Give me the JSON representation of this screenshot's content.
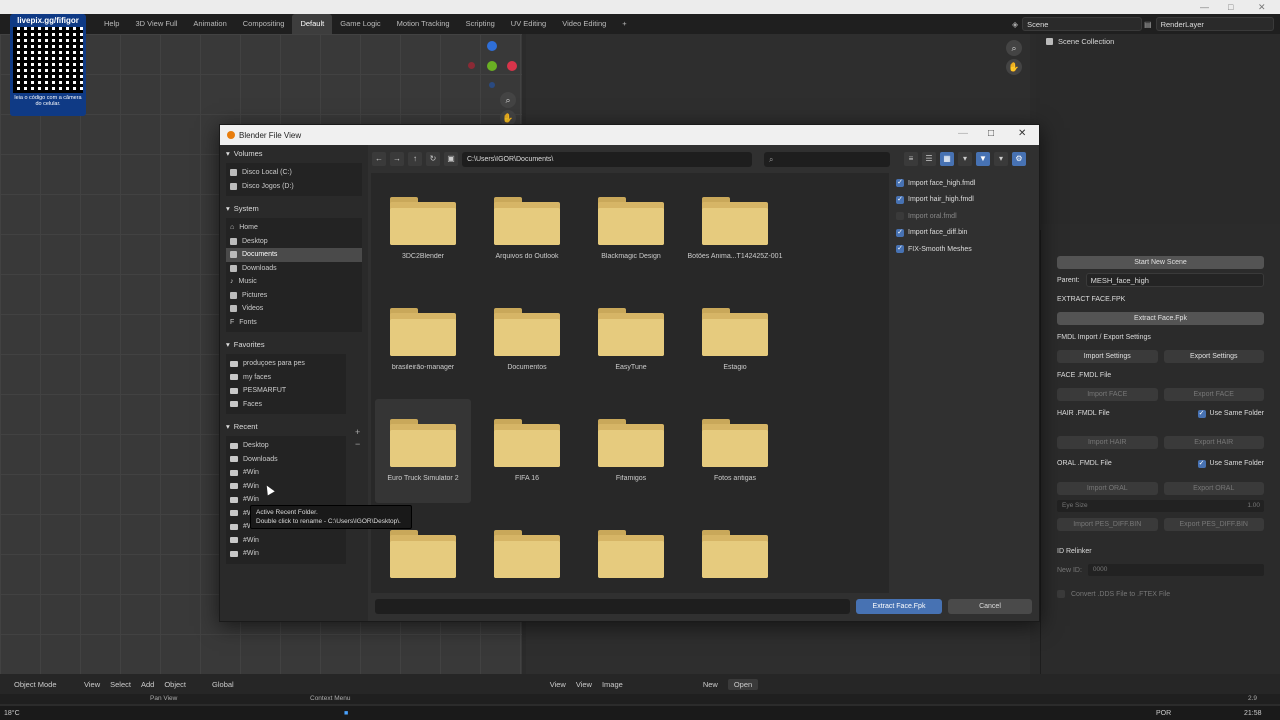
{
  "topbar": {
    "tabs": [
      "Help",
      "3D View Full",
      "Animation",
      "Compositing",
      "Default",
      "Game Logic",
      "Motion Tracking",
      "Scripting",
      "UV Editing",
      "Video Editing",
      "+"
    ],
    "scene": "Scene",
    "render_layer": "RenderLayer"
  },
  "qr": {
    "title": "livepix.gg/fifigor",
    "caption": "leia o código com a câmera do celular."
  },
  "outliner": {
    "root": "Scene Collection"
  },
  "dialog": {
    "title": "Blender File View",
    "path": "C:\\Users\\IGOR\\Documents\\",
    "sections": {
      "volumes": "Volumes",
      "system": "System",
      "favorites": "Favorites",
      "recent": "Recent"
    },
    "volumes": [
      "Disco Local (C:)",
      "Disco Jogos (D:)"
    ],
    "system": [
      "Home",
      "Desktop",
      "Documents",
      "Downloads",
      "Music",
      "Pictures",
      "Videos",
      "Fonts"
    ],
    "favorites": [
      "produçoes para pes",
      "my faces",
      "PESMARFUT",
      "Faces"
    ],
    "recent": [
      "Desktop",
      "Downloads",
      "#Win",
      "#Win",
      "#Win",
      "#Win",
      "#Win",
      "#Win",
      "#Win",
      "#Win"
    ],
    "files": [
      "3DC2Blender",
      "Arquivos do Outlook",
      "Blackmagic Design",
      "Botões Anima...T142425Z-001",
      "brasileirão-manager",
      "Documentos",
      "EasyTune",
      "Estagio",
      "Euro Truck Simulator 2",
      "FIFA 16",
      "Fifamigos",
      "Fotos antigas",
      "",
      "",
      "",
      ""
    ],
    "options": [
      {
        "label": "Import face_high.fmdl",
        "checked": true
      },
      {
        "label": "Import hair_high.fmdl",
        "checked": true
      },
      {
        "label": "Import oral.fmdl",
        "checked": false
      },
      {
        "label": "Import face_diff.bin",
        "checked": true
      },
      {
        "label": "FIX-Smooth Meshes",
        "checked": true
      }
    ],
    "primary_button": "Extract Face.Fpk",
    "cancel_button": "Cancel",
    "tooltip_line1": "Active Recent Folder.",
    "tooltip_line2": "Double click to rename - C:\\Users\\IGOR\\Desktop\\."
  },
  "properties": {
    "start_new_scene": "Start New Scene",
    "parent_label": "Parent:",
    "parent_value": "MESH_face_high",
    "extract_face_title": "EXTRACT FACE.FPK",
    "extract_face_button": "Extract Face.Fpk",
    "fmdl_settings_title": "FMDL Import / Export Settings",
    "import_settings": "Import Settings",
    "export_settings": "Export Settings",
    "face_title": "FACE .FMDL File",
    "import_face": "Import FACE",
    "export_face": "Export FACE",
    "hair_title": "HAIR .FMDL File",
    "use_same_folder": "Use Same Folder",
    "import_hair": "Import HAIR",
    "export_hair": "Export HAIR",
    "oral_title": "ORAL .FMDL File",
    "import_oral": "Import ORAL",
    "export_oral": "Export ORAL",
    "eye_size": "Eye Size",
    "eye_size_value": "1.00",
    "import_pes_diff": "Import PES_DIFF.BIN",
    "export_pes_diff": "Export PES_DIFF.BIN",
    "id_relinker": "ID Relinker",
    "new_id_label": "New ID:",
    "new_id_value": "0000",
    "convert_dds": "Convert .DDS File to .FTEX File"
  },
  "bottombar": {
    "left_items": [
      "Object Mode",
      "View",
      "Select",
      "Add",
      "Object",
      "Global"
    ],
    "right_items": [
      "View",
      "View",
      "Image",
      "New",
      "Open"
    ],
    "status_left": "Pan View",
    "status_mid": "Context Menu",
    "version": "2.9",
    "lang": "POR",
    "clock": "21:58",
    "temp": "18°C"
  }
}
